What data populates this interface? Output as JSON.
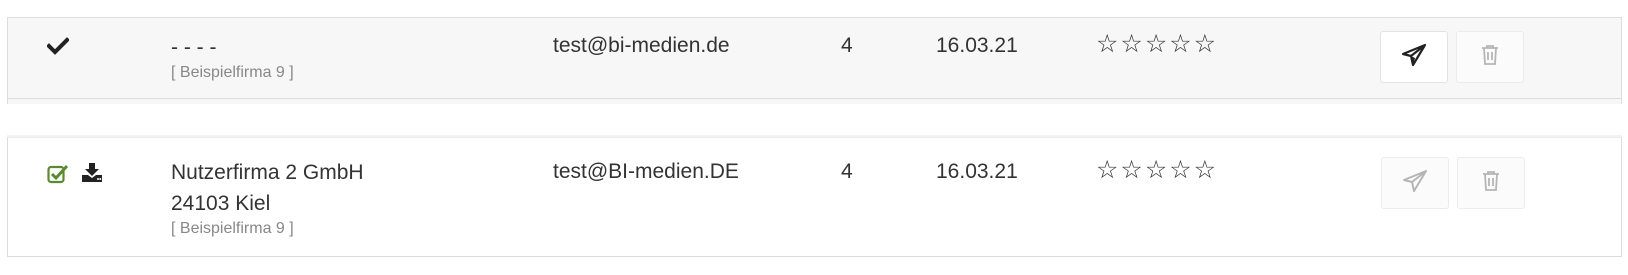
{
  "rows": [
    {
      "name_lines": [
        "- - - -"
      ],
      "company": "[ Beispielfirma 9 ]",
      "email": "test@bi-medien.de",
      "count": "4",
      "date": "16.03.21",
      "stars": "☆☆☆☆☆",
      "status_icon": "check-icon",
      "send_enabled": true
    },
    {
      "name_lines": [
        "Nutzerfirma 2 GmbH",
        "24103 Kiel"
      ],
      "company": "[ Beispielfirma 9 ]",
      "email": "test@BI-medien.DE",
      "count": "4",
      "date": "16.03.21",
      "stars": "☆☆☆☆☆",
      "status_icon": "checkbox-checked-icon",
      "extra_icon": "download-icon",
      "send_enabled": false
    }
  ],
  "colors": {
    "check_green": "#5a8a2f",
    "icon_dark": "#222222",
    "icon_muted": "#b5b5b5"
  }
}
